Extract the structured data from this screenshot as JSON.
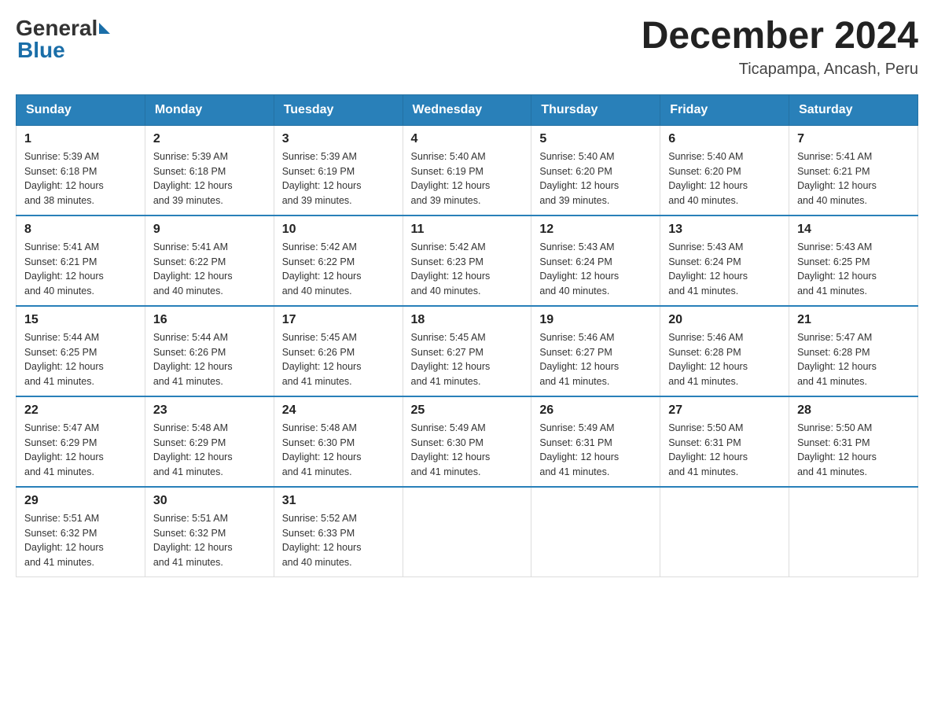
{
  "logo": {
    "general": "General",
    "blue": "Blue"
  },
  "title": {
    "month": "December 2024",
    "location": "Ticapampa, Ancash, Peru"
  },
  "days_of_week": [
    "Sunday",
    "Monday",
    "Tuesday",
    "Wednesday",
    "Thursday",
    "Friday",
    "Saturday"
  ],
  "weeks": [
    [
      {
        "day": "1",
        "sunrise": "5:39 AM",
        "sunset": "6:18 PM",
        "daylight": "12 hours and 38 minutes."
      },
      {
        "day": "2",
        "sunrise": "5:39 AM",
        "sunset": "6:18 PM",
        "daylight": "12 hours and 39 minutes."
      },
      {
        "day": "3",
        "sunrise": "5:39 AM",
        "sunset": "6:19 PM",
        "daylight": "12 hours and 39 minutes."
      },
      {
        "day": "4",
        "sunrise": "5:40 AM",
        "sunset": "6:19 PM",
        "daylight": "12 hours and 39 minutes."
      },
      {
        "day": "5",
        "sunrise": "5:40 AM",
        "sunset": "6:20 PM",
        "daylight": "12 hours and 39 minutes."
      },
      {
        "day": "6",
        "sunrise": "5:40 AM",
        "sunset": "6:20 PM",
        "daylight": "12 hours and 40 minutes."
      },
      {
        "day": "7",
        "sunrise": "5:41 AM",
        "sunset": "6:21 PM",
        "daylight": "12 hours and 40 minutes."
      }
    ],
    [
      {
        "day": "8",
        "sunrise": "5:41 AM",
        "sunset": "6:21 PM",
        "daylight": "12 hours and 40 minutes."
      },
      {
        "day": "9",
        "sunrise": "5:41 AM",
        "sunset": "6:22 PM",
        "daylight": "12 hours and 40 minutes."
      },
      {
        "day": "10",
        "sunrise": "5:42 AM",
        "sunset": "6:22 PM",
        "daylight": "12 hours and 40 minutes."
      },
      {
        "day": "11",
        "sunrise": "5:42 AM",
        "sunset": "6:23 PM",
        "daylight": "12 hours and 40 minutes."
      },
      {
        "day": "12",
        "sunrise": "5:43 AM",
        "sunset": "6:24 PM",
        "daylight": "12 hours and 40 minutes."
      },
      {
        "day": "13",
        "sunrise": "5:43 AM",
        "sunset": "6:24 PM",
        "daylight": "12 hours and 41 minutes."
      },
      {
        "day": "14",
        "sunrise": "5:43 AM",
        "sunset": "6:25 PM",
        "daylight": "12 hours and 41 minutes."
      }
    ],
    [
      {
        "day": "15",
        "sunrise": "5:44 AM",
        "sunset": "6:25 PM",
        "daylight": "12 hours and 41 minutes."
      },
      {
        "day": "16",
        "sunrise": "5:44 AM",
        "sunset": "6:26 PM",
        "daylight": "12 hours and 41 minutes."
      },
      {
        "day": "17",
        "sunrise": "5:45 AM",
        "sunset": "6:26 PM",
        "daylight": "12 hours and 41 minutes."
      },
      {
        "day": "18",
        "sunrise": "5:45 AM",
        "sunset": "6:27 PM",
        "daylight": "12 hours and 41 minutes."
      },
      {
        "day": "19",
        "sunrise": "5:46 AM",
        "sunset": "6:27 PM",
        "daylight": "12 hours and 41 minutes."
      },
      {
        "day": "20",
        "sunrise": "5:46 AM",
        "sunset": "6:28 PM",
        "daylight": "12 hours and 41 minutes."
      },
      {
        "day": "21",
        "sunrise": "5:47 AM",
        "sunset": "6:28 PM",
        "daylight": "12 hours and 41 minutes."
      }
    ],
    [
      {
        "day": "22",
        "sunrise": "5:47 AM",
        "sunset": "6:29 PM",
        "daylight": "12 hours and 41 minutes."
      },
      {
        "day": "23",
        "sunrise": "5:48 AM",
        "sunset": "6:29 PM",
        "daylight": "12 hours and 41 minutes."
      },
      {
        "day": "24",
        "sunrise": "5:48 AM",
        "sunset": "6:30 PM",
        "daylight": "12 hours and 41 minutes."
      },
      {
        "day": "25",
        "sunrise": "5:49 AM",
        "sunset": "6:30 PM",
        "daylight": "12 hours and 41 minutes."
      },
      {
        "day": "26",
        "sunrise": "5:49 AM",
        "sunset": "6:31 PM",
        "daylight": "12 hours and 41 minutes."
      },
      {
        "day": "27",
        "sunrise": "5:50 AM",
        "sunset": "6:31 PM",
        "daylight": "12 hours and 41 minutes."
      },
      {
        "day": "28",
        "sunrise": "5:50 AM",
        "sunset": "6:31 PM",
        "daylight": "12 hours and 41 minutes."
      }
    ],
    [
      {
        "day": "29",
        "sunrise": "5:51 AM",
        "sunset": "6:32 PM",
        "daylight": "12 hours and 41 minutes."
      },
      {
        "day": "30",
        "sunrise": "5:51 AM",
        "sunset": "6:32 PM",
        "daylight": "12 hours and 41 minutes."
      },
      {
        "day": "31",
        "sunrise": "5:52 AM",
        "sunset": "6:33 PM",
        "daylight": "12 hours and 40 minutes."
      },
      null,
      null,
      null,
      null
    ]
  ],
  "labels": {
    "sunrise": "Sunrise:",
    "sunset": "Sunset:",
    "daylight": "Daylight:"
  }
}
